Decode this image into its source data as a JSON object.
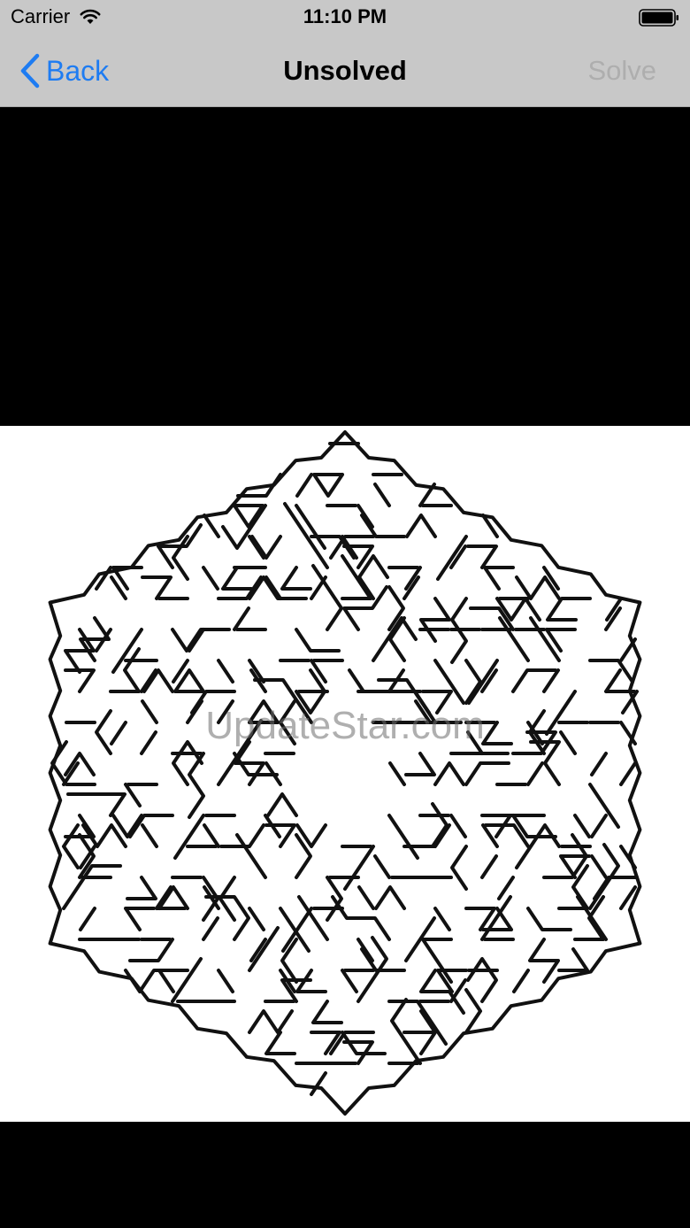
{
  "status_bar": {
    "carrier": "Carrier",
    "time": "11:10 PM"
  },
  "nav_bar": {
    "back_label": "Back",
    "title": "Unsolved",
    "solve_label": "Solve"
  },
  "maze": {
    "watermark": "UpdateStar.com"
  },
  "colors": {
    "bar_background": "#c8c8c8",
    "accent_blue": "#1e7cf2",
    "disabled_gray": "#aeaeae",
    "letterbox": "#000000"
  }
}
